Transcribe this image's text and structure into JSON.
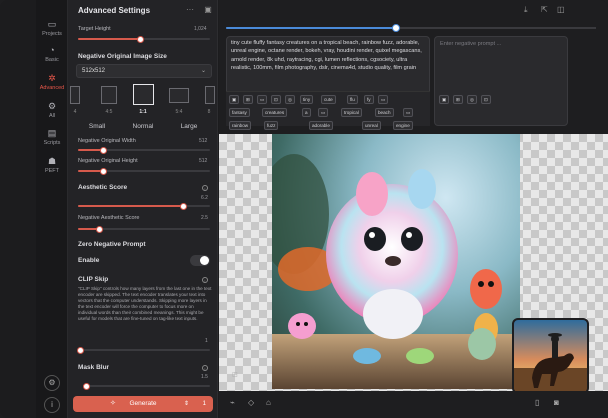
{
  "nav": {
    "items": [
      {
        "label": "Projects",
        "icon": "projects-icon"
      },
      {
        "label": "Basic",
        "icon": "basic-icon"
      },
      {
        "label": "Advanced",
        "icon": "advanced-icon",
        "active": true
      },
      {
        "label": "All",
        "icon": "all-icon"
      },
      {
        "label": "Scripts",
        "icon": "scripts-icon"
      },
      {
        "label": "PEFT",
        "icon": "peft-icon"
      }
    ]
  },
  "panel": {
    "title": "Advanced Settings",
    "target_height": {
      "label": "Target Height",
      "value": "1,024",
      "level": 0.48
    },
    "neg_image_size": {
      "label": "Negative Original Image Size",
      "selected": "512x512"
    },
    "ratios": [
      {
        "label": "4"
      },
      {
        "label": "4:5"
      },
      {
        "label": "1:1"
      },
      {
        "label": "5:4"
      },
      {
        "label": "8"
      }
    ],
    "sizes": [
      "Small",
      "Normal",
      "Large"
    ],
    "neg_orig_width": {
      "label": "Negative Original Width",
      "value": "512",
      "level": 0.2
    },
    "neg_orig_height": {
      "label": "Negative Original Height",
      "value": "512",
      "level": 0.2
    },
    "aesthetic": {
      "label": "Aesthetic Score",
      "value": "6.2",
      "level": 0.8
    },
    "neg_aesthetic": {
      "label": "Negative Aesthetic Score",
      "value": "2.5",
      "level": 0.17
    },
    "zero_neg": {
      "label": "Zero Negative Prompt",
      "enable": "Enable"
    },
    "clip_skip": {
      "label": "CLIP Skip",
      "desc": "\"CLIP Skip\" controls how many layers from the last one in the text encoder are skipped. The text encoder translates your text into vectors that the computer understands. Skipping more layers in the text encoder will force the computer to focus more on individual words than their combined meanings. This might be useful for models that are fine-tuned on tag-like text inputs.",
      "value": "1",
      "level": 0.0
    },
    "mask_blur": {
      "label": "Mask Blur",
      "value": "1.5",
      "level": 0.03
    },
    "generate": {
      "label": "Generate",
      "count": "1"
    }
  },
  "prompt": {
    "positive": "tiny cute fluffy fantasy creatures on a tropical beach, rainbow fuzz, adorable, unreal engine, octane render, bokeh, vray, houdini render, quixel megascans, arnold render, 8k uhd, raytracing, cgi, lumen reflections, cgsociety, ultra realistic, 100mm, film photography, dslr, cinema4d, studio quality, film grain",
    "negative_placeholder": "Enter negative prompt ...",
    "chips_row1": [
      "tiny",
      "cute",
      "flu",
      "fy",
      "fantasy",
      "creatures",
      "a",
      "tropical",
      "beach",
      "rainbow",
      "fuzz",
      "adorable",
      "unreal",
      "engine"
    ]
  },
  "colors": {
    "accent": "#d9614f",
    "slider_blue": "#4a8ad8"
  },
  "slider_top_level": 0.46
}
